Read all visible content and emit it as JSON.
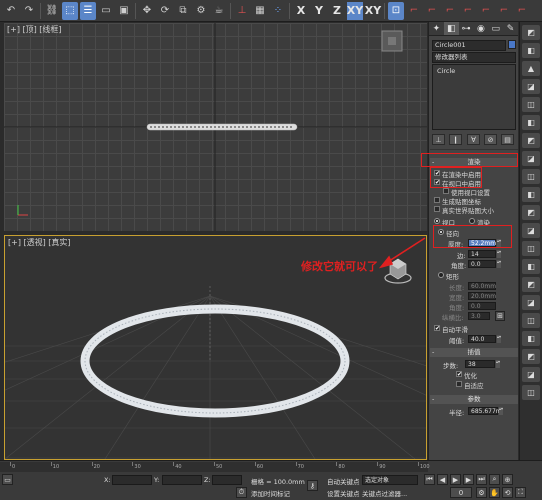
{
  "toolbar": {
    "axes": [
      "X",
      "Y",
      "Z",
      "XY",
      "XY"
    ]
  },
  "viewports": {
    "top_label": "[+] [顶] [线框]",
    "persp_label": "[+] [透视] [真实]"
  },
  "annotation": {
    "text": "修改它就可以了",
    "color": "#e02020"
  },
  "panel": {
    "object_name": "Circle001",
    "modifier_list": "修改器列表",
    "stack_item": "Circle",
    "rendering": {
      "title": "渲染",
      "enable_in_renderer": "在渲染中启用",
      "enable_in_viewport": "在视口中启用",
      "use_viewport_settings": "使用视口设置",
      "generate_mapping": "生成贴图坐标",
      "real_world_map_size": "真实世界贴图大小",
      "viewport": "视口",
      "render": "渲染",
      "radial": "径向",
      "thickness_label": "厚度:",
      "thickness": "52.2mm",
      "sides_label": "边:",
      "sides": "14",
      "angle_label": "角度:",
      "angle": "0.0",
      "rectangular": "矩形",
      "length_label": "长度:",
      "length": "60.0mm",
      "width_label": "宽度:",
      "width": "20.0mm",
      "angle2_label": "角度:",
      "angle2": "0.0",
      "aspect_label": "纵横比:",
      "aspect": "3.0",
      "auto_smooth": "自动平滑",
      "threshold_label": "阈值:",
      "threshold": "40.0"
    },
    "interpolation": {
      "title": "插值",
      "steps_label": "步数:",
      "steps": "38",
      "optimize": "优化",
      "adaptive": "自适应"
    },
    "parameters": {
      "title": "参数",
      "radius_label": "半径:",
      "radius": "685.677m"
    }
  },
  "statusbar": {
    "timeline_ticks": [
      "0",
      "10",
      "20",
      "30",
      "40",
      "50",
      "60",
      "70",
      "80",
      "90",
      "100"
    ],
    "x_label": "X:",
    "y_label": "Y:",
    "z_label": "Z:",
    "grid": "栅格 = 100.0mm",
    "add_time_tag": "添加时间标记",
    "auto_key": "自动关键点",
    "selected": "选定对象",
    "set_key": "设置关键点",
    "key_filters": "关键点过滤器..."
  },
  "colors": {
    "accent": "#5b86c8",
    "highlight": "#e02020",
    "active_border": "#c8a030"
  }
}
